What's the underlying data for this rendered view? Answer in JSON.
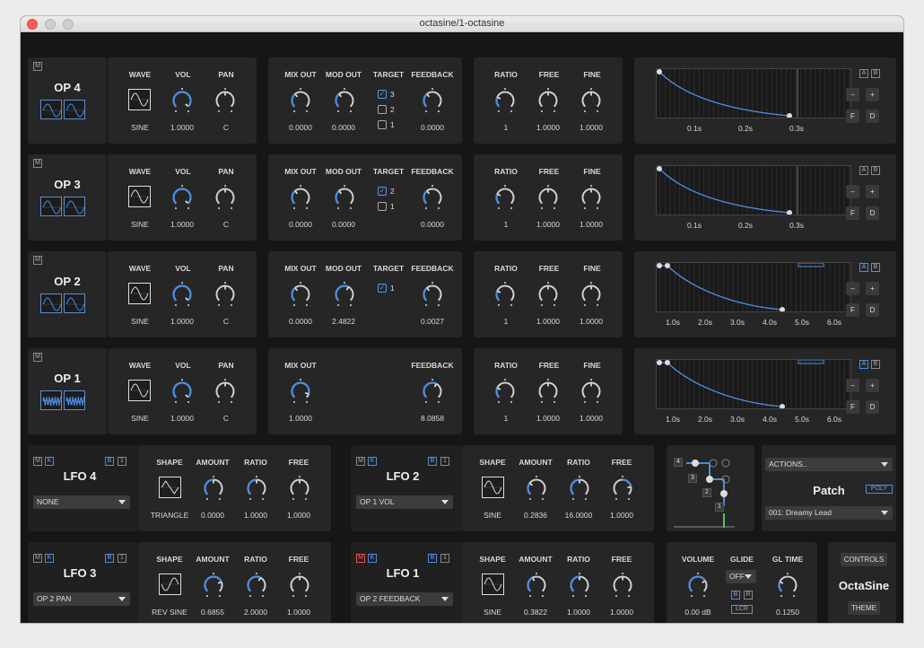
{
  "window": {
    "title": "octasine/1-octasine"
  },
  "colors": {
    "accent": "#4d8de0",
    "panel": "#262626",
    "bg": "#161616"
  },
  "operators": [
    {
      "name": "OP 4",
      "wave": "SINE",
      "vol": "1.0000",
      "pan": "C",
      "mix_out": "0.0000",
      "mod_out": "0.0000",
      "targets": [
        {
          "label": "3",
          "checked": true
        },
        {
          "label": "2",
          "checked": false
        },
        {
          "label": "1",
          "checked": false
        }
      ],
      "feedback": "0.0000",
      "ratio": "1",
      "free": "1.0000",
      "fine": "1.0000",
      "env_ticks": [
        "0.1s",
        "0.2s",
        "0.3s"
      ],
      "ab": [
        "A",
        "B"
      ],
      "ab_active": ""
    },
    {
      "name": "OP 3",
      "wave": "SINE",
      "vol": "1.0000",
      "pan": "C",
      "mix_out": "0.0000",
      "mod_out": "0.0000",
      "targets": [
        {
          "label": "2",
          "checked": true
        },
        {
          "label": "1",
          "checked": false
        }
      ],
      "feedback": "0.0000",
      "ratio": "1",
      "free": "1.0000",
      "fine": "1.0000",
      "env_ticks": [
        "0.1s",
        "0.2s",
        "0.3s"
      ],
      "ab": [
        "A",
        "B"
      ],
      "ab_active": ""
    },
    {
      "name": "OP 2",
      "wave": "SINE",
      "vol": "1.0000",
      "pan": "C",
      "mix_out": "0.0000",
      "mod_out": "2.4822",
      "targets": [
        {
          "label": "1",
          "checked": true
        }
      ],
      "feedback": "0.0027",
      "ratio": "1",
      "free": "1.0000",
      "fine": "1.0000",
      "env_ticks": [
        "1.0s",
        "2.0s",
        "3.0s",
        "4.0s",
        "5.0s",
        "6.0s"
      ],
      "ab": [
        "A",
        "B"
      ],
      "ab_active": "A"
    },
    {
      "name": "OP 1",
      "wave": "SINE",
      "vol": "1.0000",
      "pan": "C",
      "mix_out": "1.0000",
      "mod_out": "",
      "targets": [],
      "feedback": "8.0858",
      "ratio": "1",
      "free": "1.0000",
      "fine": "1.0000",
      "env_ticks": [
        "1.0s",
        "2.0s",
        "3.0s",
        "4.0s",
        "5.0s",
        "6.0s"
      ],
      "ab": [
        "A",
        "B"
      ],
      "ab_active": "A"
    }
  ],
  "op_labels": {
    "mute": "M",
    "wave": "WAVE",
    "vol": "VOL",
    "pan": "PAN",
    "mix_out": "MIX OUT",
    "mod_out": "MOD OUT",
    "target": "TARGET",
    "feedback": "FEEDBACK",
    "ratio": "RATIO",
    "free": "FREE",
    "fine": "FINE",
    "minus": "–",
    "plus": "+",
    "f": "F",
    "d": "D"
  },
  "lfo_labels": {
    "m": "M",
    "k": "K",
    "b": "B",
    "one": "1",
    "shape": "SHAPE",
    "amount": "AMOUNT",
    "ratio": "RATIO",
    "free": "FREE"
  },
  "lfos": [
    {
      "name": "LFO 4",
      "target": "NONE",
      "shape": "TRIANGLE",
      "amount": "0.0000",
      "ratio": "1.0000",
      "free": "1.0000"
    },
    {
      "name": "LFO 2",
      "target": "OP 1 VOL",
      "shape": "SINE",
      "amount": "0.2836",
      "ratio": "16.0000",
      "free": "1.0000"
    },
    {
      "name": "LFO 3",
      "target": "OP 2 PAN",
      "shape": "REV SINE",
      "amount": "0.6855",
      "ratio": "2.0000",
      "free": "1.0000"
    },
    {
      "name": "LFO 1",
      "target": "OP 2 FEEDBACK",
      "shape": "SINE",
      "amount": "0.3822",
      "ratio": "1.0000",
      "free": "1.0000"
    }
  ],
  "routing": {
    "nodes": [
      "4",
      "3",
      "2",
      "1"
    ]
  },
  "patch": {
    "actions": "ACTIONS..",
    "title": "Patch",
    "poly": "POLY",
    "current": "001: Dreamy Lead"
  },
  "master": {
    "volume_label": "VOLUME",
    "volume": "0.00 dB",
    "glide_label": "GLIDE",
    "glide": "OFF",
    "b": "B",
    "r": "R",
    "lcr": "LCR",
    "gltime_label": "GL TIME",
    "gltime": "0.1250"
  },
  "brand": {
    "controls": "CONTROLS",
    "name": "OctaSine",
    "theme": "THEME"
  }
}
